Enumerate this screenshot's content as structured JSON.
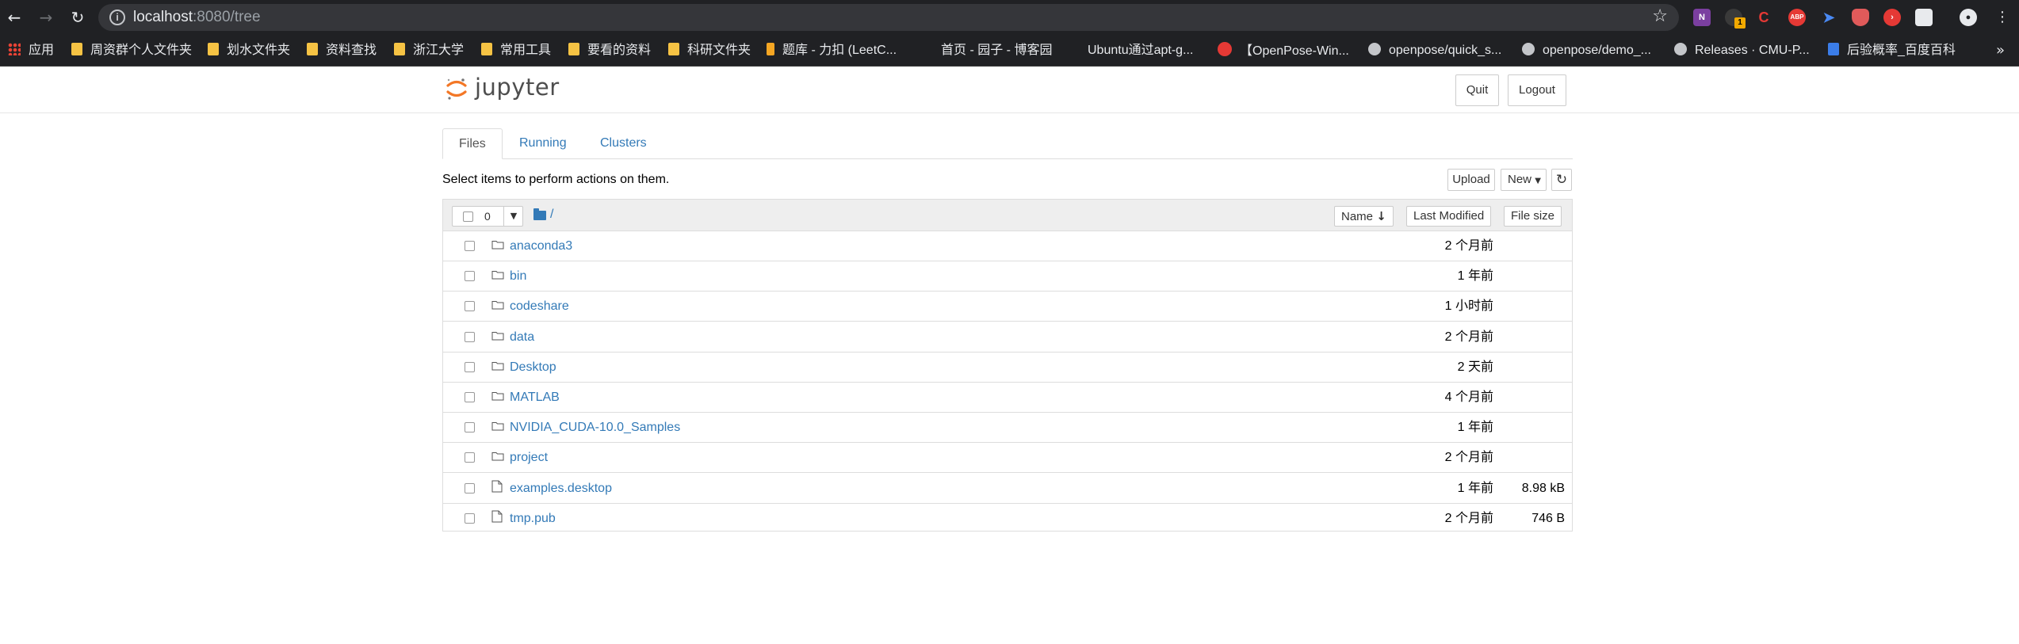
{
  "browser": {
    "url_host": "localhost",
    "url_path": ":8080/tree",
    "bookmarks": [
      {
        "label": "应用",
        "icon": "apps-grid-icon"
      },
      {
        "label": "周资群个人文件夹",
        "icon": "folder-icon"
      },
      {
        "label": "划水文件夹",
        "icon": "folder-icon"
      },
      {
        "label": "资料查找",
        "icon": "folder-icon"
      },
      {
        "label": "浙江大学",
        "icon": "folder-icon"
      },
      {
        "label": "常用工具",
        "icon": "folder-icon"
      },
      {
        "label": "要看的资料",
        "icon": "folder-icon"
      },
      {
        "label": "科研文件夹",
        "icon": "folder-icon"
      },
      {
        "label": "题库 - 力扣 (LeetC...",
        "icon": "leetcode-icon"
      },
      {
        "label": "首页 - 园子 - 博客园",
        "icon": "page-icon"
      },
      {
        "label": "Ubuntu通过apt-g...",
        "icon": "page-icon"
      },
      {
        "label": "【OpenPose-Win...",
        "icon": "csdn-icon"
      },
      {
        "label": "openpose/quick_s...",
        "icon": "github-icon"
      },
      {
        "label": "openpose/demo_...",
        "icon": "github-icon"
      },
      {
        "label": "Releases · CMU-P...",
        "icon": "github-icon"
      },
      {
        "label": "后验概率_百度百科",
        "icon": "baidu-icon"
      }
    ],
    "ext_badge": "1"
  },
  "header": {
    "logo_text": "jupyter",
    "quit_label": "Quit",
    "logout_label": "Logout"
  },
  "tabs": [
    {
      "label": "Files",
      "active": true
    },
    {
      "label": "Running",
      "active": false
    },
    {
      "label": "Clusters",
      "active": false
    }
  ],
  "toolbar": {
    "hint": "Select items to perform actions on them.",
    "upload_label": "Upload",
    "new_label": "New"
  },
  "list": {
    "selected_count": "0",
    "breadcrumb": "/",
    "sort_name": "Name",
    "sort_modified": "Last Modified",
    "sort_size": "File size",
    "items": [
      {
        "name": "anaconda3",
        "type": "folder",
        "modified": "2 个月前",
        "size": ""
      },
      {
        "name": "bin",
        "type": "folder",
        "modified": "1 年前",
        "size": ""
      },
      {
        "name": "codeshare",
        "type": "folder",
        "modified": "1 小时前",
        "size": ""
      },
      {
        "name": "data",
        "type": "folder",
        "modified": "2 个月前",
        "size": ""
      },
      {
        "name": "Desktop",
        "type": "folder",
        "modified": "2 天前",
        "size": ""
      },
      {
        "name": "MATLAB",
        "type": "folder",
        "modified": "4 个月前",
        "size": ""
      },
      {
        "name": "NVIDIA_CUDA-10.0_Samples",
        "type": "folder",
        "modified": "1 年前",
        "size": ""
      },
      {
        "name": "project",
        "type": "folder",
        "modified": "2 个月前",
        "size": ""
      },
      {
        "name": "examples.desktop",
        "type": "file",
        "modified": "1 年前",
        "size": "8.98 kB"
      },
      {
        "name": "tmp.pub",
        "type": "file",
        "modified": "2 个月前",
        "size": "746 B"
      }
    ]
  },
  "colors": {
    "link": "#337ab7",
    "chrome_bg": "#202124",
    "jupyter_orange": "#f37726"
  }
}
